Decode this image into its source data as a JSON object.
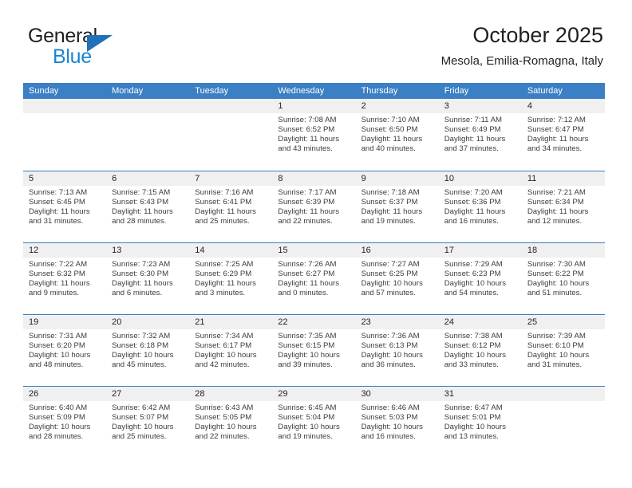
{
  "brand": {
    "name_part1": "General",
    "name_part2": "Blue",
    "triangle_color": "#1f71b8",
    "blue_text_color": "#1b84d1"
  },
  "header": {
    "month_title": "October 2025",
    "location": "Mesola, Emilia-Romagna, Italy"
  },
  "theme": {
    "header_row_bg": "#3b7fc4",
    "day_band_bg": "#f0f0f0",
    "text_color": "#231f20"
  },
  "weekdays": [
    "Sunday",
    "Monday",
    "Tuesday",
    "Wednesday",
    "Thursday",
    "Friday",
    "Saturday"
  ],
  "weeks": [
    [
      {
        "day": "",
        "empty": true,
        "sunrise": "",
        "sunset": "",
        "daylight_line1": "",
        "daylight_line2": ""
      },
      {
        "day": "",
        "empty": true,
        "sunrise": "",
        "sunset": "",
        "daylight_line1": "",
        "daylight_line2": ""
      },
      {
        "day": "",
        "empty": true,
        "sunrise": "",
        "sunset": "",
        "daylight_line1": "",
        "daylight_line2": ""
      },
      {
        "day": "1",
        "empty": false,
        "sunrise": "Sunrise: 7:08 AM",
        "sunset": "Sunset: 6:52 PM",
        "daylight_line1": "Daylight: 11 hours",
        "daylight_line2": "and 43 minutes."
      },
      {
        "day": "2",
        "empty": false,
        "sunrise": "Sunrise: 7:10 AM",
        "sunset": "Sunset: 6:50 PM",
        "daylight_line1": "Daylight: 11 hours",
        "daylight_line2": "and 40 minutes."
      },
      {
        "day": "3",
        "empty": false,
        "sunrise": "Sunrise: 7:11 AM",
        "sunset": "Sunset: 6:49 PM",
        "daylight_line1": "Daylight: 11 hours",
        "daylight_line2": "and 37 minutes."
      },
      {
        "day": "4",
        "empty": false,
        "sunrise": "Sunrise: 7:12 AM",
        "sunset": "Sunset: 6:47 PM",
        "daylight_line1": "Daylight: 11 hours",
        "daylight_line2": "and 34 minutes."
      }
    ],
    [
      {
        "day": "5",
        "empty": false,
        "sunrise": "Sunrise: 7:13 AM",
        "sunset": "Sunset: 6:45 PM",
        "daylight_line1": "Daylight: 11 hours",
        "daylight_line2": "and 31 minutes."
      },
      {
        "day": "6",
        "empty": false,
        "sunrise": "Sunrise: 7:15 AM",
        "sunset": "Sunset: 6:43 PM",
        "daylight_line1": "Daylight: 11 hours",
        "daylight_line2": "and 28 minutes."
      },
      {
        "day": "7",
        "empty": false,
        "sunrise": "Sunrise: 7:16 AM",
        "sunset": "Sunset: 6:41 PM",
        "daylight_line1": "Daylight: 11 hours",
        "daylight_line2": "and 25 minutes."
      },
      {
        "day": "8",
        "empty": false,
        "sunrise": "Sunrise: 7:17 AM",
        "sunset": "Sunset: 6:39 PM",
        "daylight_line1": "Daylight: 11 hours",
        "daylight_line2": "and 22 minutes."
      },
      {
        "day": "9",
        "empty": false,
        "sunrise": "Sunrise: 7:18 AM",
        "sunset": "Sunset: 6:37 PM",
        "daylight_line1": "Daylight: 11 hours",
        "daylight_line2": "and 19 minutes."
      },
      {
        "day": "10",
        "empty": false,
        "sunrise": "Sunrise: 7:20 AM",
        "sunset": "Sunset: 6:36 PM",
        "daylight_line1": "Daylight: 11 hours",
        "daylight_line2": "and 16 minutes."
      },
      {
        "day": "11",
        "empty": false,
        "sunrise": "Sunrise: 7:21 AM",
        "sunset": "Sunset: 6:34 PM",
        "daylight_line1": "Daylight: 11 hours",
        "daylight_line2": "and 12 minutes."
      }
    ],
    [
      {
        "day": "12",
        "empty": false,
        "sunrise": "Sunrise: 7:22 AM",
        "sunset": "Sunset: 6:32 PM",
        "daylight_line1": "Daylight: 11 hours",
        "daylight_line2": "and 9 minutes."
      },
      {
        "day": "13",
        "empty": false,
        "sunrise": "Sunrise: 7:23 AM",
        "sunset": "Sunset: 6:30 PM",
        "daylight_line1": "Daylight: 11 hours",
        "daylight_line2": "and 6 minutes."
      },
      {
        "day": "14",
        "empty": false,
        "sunrise": "Sunrise: 7:25 AM",
        "sunset": "Sunset: 6:29 PM",
        "daylight_line1": "Daylight: 11 hours",
        "daylight_line2": "and 3 minutes."
      },
      {
        "day": "15",
        "empty": false,
        "sunrise": "Sunrise: 7:26 AM",
        "sunset": "Sunset: 6:27 PM",
        "daylight_line1": "Daylight: 11 hours",
        "daylight_line2": "and 0 minutes."
      },
      {
        "day": "16",
        "empty": false,
        "sunrise": "Sunrise: 7:27 AM",
        "sunset": "Sunset: 6:25 PM",
        "daylight_line1": "Daylight: 10 hours",
        "daylight_line2": "and 57 minutes."
      },
      {
        "day": "17",
        "empty": false,
        "sunrise": "Sunrise: 7:29 AM",
        "sunset": "Sunset: 6:23 PM",
        "daylight_line1": "Daylight: 10 hours",
        "daylight_line2": "and 54 minutes."
      },
      {
        "day": "18",
        "empty": false,
        "sunrise": "Sunrise: 7:30 AM",
        "sunset": "Sunset: 6:22 PM",
        "daylight_line1": "Daylight: 10 hours",
        "daylight_line2": "and 51 minutes."
      }
    ],
    [
      {
        "day": "19",
        "empty": false,
        "sunrise": "Sunrise: 7:31 AM",
        "sunset": "Sunset: 6:20 PM",
        "daylight_line1": "Daylight: 10 hours",
        "daylight_line2": "and 48 minutes."
      },
      {
        "day": "20",
        "empty": false,
        "sunrise": "Sunrise: 7:32 AM",
        "sunset": "Sunset: 6:18 PM",
        "daylight_line1": "Daylight: 10 hours",
        "daylight_line2": "and 45 minutes."
      },
      {
        "day": "21",
        "empty": false,
        "sunrise": "Sunrise: 7:34 AM",
        "sunset": "Sunset: 6:17 PM",
        "daylight_line1": "Daylight: 10 hours",
        "daylight_line2": "and 42 minutes."
      },
      {
        "day": "22",
        "empty": false,
        "sunrise": "Sunrise: 7:35 AM",
        "sunset": "Sunset: 6:15 PM",
        "daylight_line1": "Daylight: 10 hours",
        "daylight_line2": "and 39 minutes."
      },
      {
        "day": "23",
        "empty": false,
        "sunrise": "Sunrise: 7:36 AM",
        "sunset": "Sunset: 6:13 PM",
        "daylight_line1": "Daylight: 10 hours",
        "daylight_line2": "and 36 minutes."
      },
      {
        "day": "24",
        "empty": false,
        "sunrise": "Sunrise: 7:38 AM",
        "sunset": "Sunset: 6:12 PM",
        "daylight_line1": "Daylight: 10 hours",
        "daylight_line2": "and 33 minutes."
      },
      {
        "day": "25",
        "empty": false,
        "sunrise": "Sunrise: 7:39 AM",
        "sunset": "Sunset: 6:10 PM",
        "daylight_line1": "Daylight: 10 hours",
        "daylight_line2": "and 31 minutes."
      }
    ],
    [
      {
        "day": "26",
        "empty": false,
        "sunrise": "Sunrise: 6:40 AM",
        "sunset": "Sunset: 5:09 PM",
        "daylight_line1": "Daylight: 10 hours",
        "daylight_line2": "and 28 minutes."
      },
      {
        "day": "27",
        "empty": false,
        "sunrise": "Sunrise: 6:42 AM",
        "sunset": "Sunset: 5:07 PM",
        "daylight_line1": "Daylight: 10 hours",
        "daylight_line2": "and 25 minutes."
      },
      {
        "day": "28",
        "empty": false,
        "sunrise": "Sunrise: 6:43 AM",
        "sunset": "Sunset: 5:05 PM",
        "daylight_line1": "Daylight: 10 hours",
        "daylight_line2": "and 22 minutes."
      },
      {
        "day": "29",
        "empty": false,
        "sunrise": "Sunrise: 6:45 AM",
        "sunset": "Sunset: 5:04 PM",
        "daylight_line1": "Daylight: 10 hours",
        "daylight_line2": "and 19 minutes."
      },
      {
        "day": "30",
        "empty": false,
        "sunrise": "Sunrise: 6:46 AM",
        "sunset": "Sunset: 5:03 PM",
        "daylight_line1": "Daylight: 10 hours",
        "daylight_line2": "and 16 minutes."
      },
      {
        "day": "31",
        "empty": false,
        "sunrise": "Sunrise: 6:47 AM",
        "sunset": "Sunset: 5:01 PM",
        "daylight_line1": "Daylight: 10 hours",
        "daylight_line2": "and 13 minutes."
      },
      {
        "day": "",
        "empty": true,
        "sunrise": "",
        "sunset": "",
        "daylight_line1": "",
        "daylight_line2": ""
      }
    ]
  ]
}
